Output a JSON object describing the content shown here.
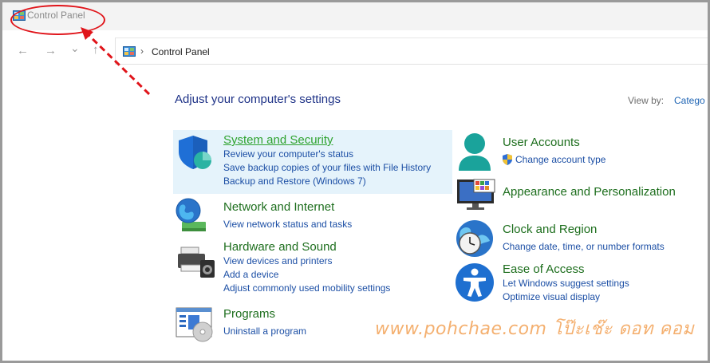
{
  "window": {
    "title": "Control Panel",
    "icon": "control-panel-icon"
  },
  "nav": {
    "back_icon": "back-arrow-icon",
    "forward_icon": "forward-arrow-icon",
    "recent_icon": "chevron-down-icon",
    "up_icon": "up-arrow-icon",
    "back_glyph": "←",
    "forward_glyph": "→",
    "recent_glyph": "⌄",
    "up_glyph": "↑"
  },
  "address": {
    "separator": "›",
    "location": "Control Panel"
  },
  "main": {
    "heading": "Adjust your computer's settings",
    "view_by_label": "View by:",
    "view_by_value": "Catego"
  },
  "categories_left": [
    {
      "title": "System and Security",
      "icon": "shield-icon",
      "links": [
        "Review your computer's status",
        "Save backup copies of your files with File History",
        "Backup and Restore (Windows 7)"
      ]
    },
    {
      "title": "Network and Internet",
      "icon": "globe-network-icon",
      "links": [
        "View network status and tasks"
      ]
    },
    {
      "title": "Hardware and Sound",
      "icon": "printer-speaker-icon",
      "links": [
        "View devices and printers",
        "Add a device",
        "Adjust commonly used mobility settings"
      ]
    },
    {
      "title": "Programs",
      "icon": "programs-disc-icon",
      "links": [
        "Uninstall a program"
      ]
    }
  ],
  "categories_right": [
    {
      "title": "User Accounts",
      "icon": "user-icon",
      "links": [
        "Change account type"
      ]
    },
    {
      "title": "Appearance and Personalization",
      "icon": "monitor-palette-icon",
      "links": []
    },
    {
      "title": "Clock and Region",
      "icon": "clock-globe-icon",
      "links": [
        "Change date, time, or number formats"
      ]
    },
    {
      "title": "Ease of Access",
      "icon": "accessibility-icon",
      "links": [
        "Let Windows suggest settings",
        "Optimize visual display"
      ]
    }
  ],
  "annotation": {
    "watermark": "www.pohchae.com  โป๊ะเช๊ะ ดอท คอม",
    "ellipse_color": "#e0141a",
    "arrow_color": "#e0141a"
  },
  "colors": {
    "heading": "#1e3287",
    "category_title": "#1d6e1d",
    "link": "#1c4fa5",
    "highlight": "#e5f3fb"
  }
}
